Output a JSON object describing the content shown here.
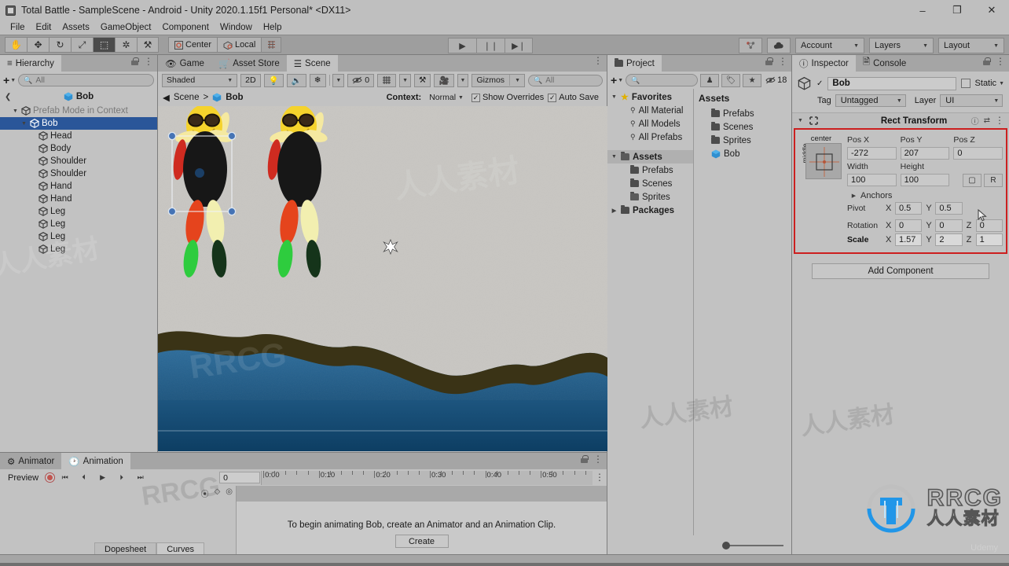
{
  "window": {
    "title": "Total Battle - SampleScene - Android - Unity 2020.1.15f1 Personal* <DX11>",
    "minimize": "–",
    "maximize": "❐",
    "close": "✕"
  },
  "menubar": {
    "items": [
      "File",
      "Edit",
      "Assets",
      "GameObject",
      "Component",
      "Window",
      "Help"
    ]
  },
  "toolbar": {
    "tools": [
      {
        "name": "hand-tool",
        "glyph": "✋",
        "active": false
      },
      {
        "name": "move-tool",
        "glyph": "✥",
        "active": false
      },
      {
        "name": "rotate-tool",
        "glyph": "↻",
        "active": false
      },
      {
        "name": "scale-tool",
        "glyph": "⤢",
        "active": false
      },
      {
        "name": "rect-tool",
        "glyph": "⬚",
        "active": true
      },
      {
        "name": "transform-tool",
        "glyph": "✲",
        "active": false
      },
      {
        "name": "custom-tool",
        "glyph": "⚒",
        "active": false
      }
    ],
    "pivot_mode": "Center",
    "pivot_rotation": "Local",
    "pivot_extra_icon": "grid-snap-icon",
    "play": "▶",
    "pause": "❘❘",
    "step": "▶❘",
    "collab_icon": "collab-icon",
    "cloud_icon": "cloud-icon",
    "account": "Account",
    "layers": "Layers",
    "layout": "Layout"
  },
  "hierarchy": {
    "tab_label": "Hierarchy",
    "search_placeholder": "All",
    "plus_label": "+",
    "breadcrumb": "Bob",
    "rows": [
      {
        "label": "Prefab Mode in Context",
        "indent": 1,
        "arrow": "open",
        "dim": true,
        "icon": "prefab-icon",
        "selected": false
      },
      {
        "label": "Bob",
        "indent": 2,
        "arrow": "open",
        "dim": false,
        "icon": "prefab-icon",
        "selected": true
      },
      {
        "label": "Head",
        "indent": 3,
        "arrow": "none",
        "dim": false,
        "icon": "gameobject-icon",
        "selected": false
      },
      {
        "label": "Body",
        "indent": 3,
        "arrow": "none",
        "dim": false,
        "icon": "gameobject-icon",
        "selected": false
      },
      {
        "label": "Shoulder",
        "indent": 3,
        "arrow": "none",
        "dim": false,
        "icon": "gameobject-icon",
        "selected": false
      },
      {
        "label": "Shoulder",
        "indent": 3,
        "arrow": "none",
        "dim": false,
        "icon": "gameobject-icon",
        "selected": false
      },
      {
        "label": "Hand",
        "indent": 3,
        "arrow": "none",
        "dim": false,
        "icon": "gameobject-icon",
        "selected": false
      },
      {
        "label": "Hand",
        "indent": 3,
        "arrow": "none",
        "dim": false,
        "icon": "gameobject-icon",
        "selected": false
      },
      {
        "label": "Leg",
        "indent": 3,
        "arrow": "none",
        "dim": false,
        "icon": "gameobject-icon",
        "selected": false
      },
      {
        "label": "Leg",
        "indent": 3,
        "arrow": "none",
        "dim": false,
        "icon": "gameobject-icon",
        "selected": false
      },
      {
        "label": "Leg",
        "indent": 3,
        "arrow": "none",
        "dim": false,
        "icon": "gameobject-icon",
        "selected": false
      },
      {
        "label": "Leg",
        "indent": 3,
        "arrow": "none",
        "dim": false,
        "icon": "gameobject-icon",
        "selected": false
      }
    ]
  },
  "scene": {
    "tabs": [
      {
        "label": "Game",
        "icon": "game-icon",
        "active": false
      },
      {
        "label": "Asset Store",
        "icon": "store-icon",
        "active": false
      },
      {
        "label": "Scene",
        "icon": "scene-icon",
        "active": true
      }
    ],
    "draw_mode": "Shaded",
    "two_d": "2D",
    "light_icon": "lighting-icon",
    "audio_icon": "audio-icon",
    "fx_icon": "effects-icon",
    "hidden_count": "0",
    "grid_icon": "grid-icon",
    "component_icon": "component-tools-icon",
    "camera_icon": "scene-camera-icon",
    "gizmos": "Gizmos",
    "search_placeholder": "All",
    "breadcrumb_root": "Scene",
    "breadcrumb_leaf": "Bob",
    "context_label": "Context:",
    "context_value": "Normal",
    "show_overrides": "Show Overrides",
    "show_overrides_checked": true,
    "auto_save": "Auto Save",
    "auto_save_checked": true
  },
  "project": {
    "tab_label": "Project",
    "search_placeholder": "",
    "icon_buttons": [
      "avatar-filter-icon",
      "label-filter-icon",
      "favorite-filter-icon"
    ],
    "hidden_count": "18",
    "tree": [
      {
        "label": "Favorites",
        "indent": 0,
        "arrow": "open",
        "icon": "star-icon",
        "bold": true
      },
      {
        "label": "All Material",
        "indent": 1,
        "arrow": "none",
        "icon": "search-icon",
        "bold": false
      },
      {
        "label": "All Models",
        "indent": 1,
        "arrow": "none",
        "icon": "search-icon",
        "bold": false
      },
      {
        "label": "All Prefabs",
        "indent": 1,
        "arrow": "none",
        "icon": "search-icon",
        "bold": false
      },
      {
        "label": "",
        "indent": 0,
        "arrow": "none",
        "icon": "spacer",
        "bold": false
      },
      {
        "label": "Assets",
        "indent": 0,
        "arrow": "open",
        "icon": "folder-open-icon",
        "bold": true,
        "selected": true
      },
      {
        "label": "Prefabs",
        "indent": 1,
        "arrow": "none",
        "icon": "folder-icon",
        "bold": false
      },
      {
        "label": "Scenes",
        "indent": 1,
        "arrow": "none",
        "icon": "folder-icon",
        "bold": false
      },
      {
        "label": "Sprites",
        "indent": 1,
        "arrow": "none",
        "icon": "folder-open-icon",
        "bold": false
      },
      {
        "label": "Packages",
        "indent": 0,
        "arrow": "closed",
        "icon": "folder-icon",
        "bold": true
      }
    ],
    "content_header": "Assets",
    "content": [
      {
        "label": "Prefabs",
        "icon": "folder-icon"
      },
      {
        "label": "Scenes",
        "icon": "folder-icon"
      },
      {
        "label": "Sprites",
        "icon": "folder-icon"
      },
      {
        "label": "Bob",
        "icon": "prefab-icon"
      }
    ]
  },
  "inspector": {
    "tabs": [
      {
        "label": "Inspector",
        "icon": "info-icon",
        "active": true
      },
      {
        "label": "Console",
        "icon": "console-icon",
        "active": false
      }
    ],
    "enabled_checked": true,
    "object_name": "Bob",
    "static_label": "Static",
    "static_checked": false,
    "tag_label": "Tag",
    "tag_value": "Untagged",
    "layer_label": "Layer",
    "layer_value": "UI",
    "component": {
      "title": "Rect Transform",
      "help_icon": "help-icon",
      "preset_icon": "preset-icon",
      "menu_icon": "kebab-icon",
      "anchor_h_label": "center",
      "anchor_v_label": "middle",
      "labels": {
        "pos_x": "Pos X",
        "pos_y": "Pos Y",
        "pos_z": "Pos Z",
        "width": "Width",
        "height": "Height",
        "anchors": "Anchors",
        "pivot": "Pivot",
        "rotation": "Rotation",
        "scale": "Scale",
        "blueprint_icon": "blueprint-mode-icon",
        "raw_label": "R"
      },
      "values": {
        "pos_x": "-272",
        "pos_y": "207",
        "pos_z": "0",
        "width": "100",
        "height": "100",
        "pivot_x": "0.5",
        "pivot_y": "0.5",
        "rot_x": "0",
        "rot_y": "0",
        "rot_z": "0",
        "scale_x": "1.57",
        "scale_y": "2",
        "scale_z": "1"
      },
      "highlight_color": "#cc1f1f"
    },
    "add_component": "Add Component"
  },
  "animation": {
    "tabs": [
      {
        "label": "Animator",
        "icon": "animator-icon",
        "active": false
      },
      {
        "label": "Animation",
        "icon": "animation-icon",
        "active": true
      }
    ],
    "preview_label": "Preview",
    "record_icon": "record-icon",
    "transport": [
      "⏮",
      "⏴",
      "▶",
      "⏵",
      "⏭"
    ],
    "frame_value": "0",
    "timeline_labels": [
      "0:00",
      "0:10",
      "0:20",
      "0:30",
      "0:40",
      "0:50"
    ],
    "key_icons": [
      "add-keyframe-icon",
      "add-property-key-icon",
      "add-event-icon"
    ],
    "empty_message": "To begin animating Bob, create an Animator and an Animation Clip.",
    "create_button": "Create",
    "bottom_tabs": [
      {
        "label": "Dopesheet",
        "active": false
      },
      {
        "label": "Curves",
        "active": true
      }
    ]
  },
  "branding": {
    "logo_main": "RRCG",
    "logo_sub": "人人素材",
    "udemy": "Udemy",
    "watermarks": [
      "人人素材",
      "RRCG"
    ]
  }
}
